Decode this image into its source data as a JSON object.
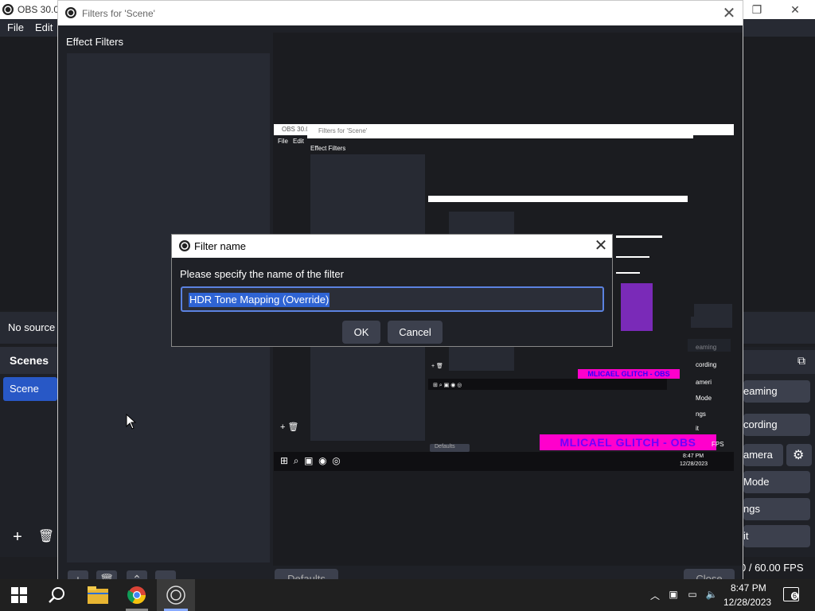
{
  "main_window": {
    "title": "OBS 30.0",
    "menu": [
      "File",
      "Edit"
    ],
    "sources_empty_text": "No source",
    "scenes_header": "Scenes",
    "scene_item": "Scene",
    "controls": [
      "eaming",
      "cording",
      "amera",
      "Mode",
      "ngs",
      "it"
    ],
    "status_fps": "0 / 60.00 FPS"
  },
  "filters_window": {
    "title": "Filters for 'Scene'",
    "effect_filters_label": "Effect Filters",
    "defaults_label": "Defaults",
    "close_label": "Close"
  },
  "preview": {
    "inner_title": "OBS 30.0",
    "inner_filters_title": "Filters for 'Scene'",
    "inner_menu_file": "File",
    "inner_menu_edit": "Edit",
    "inner_effect_filters": "Effect Filters",
    "glitch_text_a": "MLICAEL",
    "glitch_text_b": "GLITCH - OBS",
    "glitch_small": "MLICAEL GLITCH - OBS",
    "inner_time": "8:47 PM",
    "inner_date": "12/28/2023",
    "inner_defaults": "Defaults",
    "inner_controls": [
      "eaming",
      "cording",
      "ameri",
      "Mode",
      "ngs",
      "it"
    ],
    "inner_fps": "FPS"
  },
  "dialog": {
    "title": "Filter name",
    "prompt": "Please specify the name of the filter",
    "input_value": "HDR Tone Mapping (Override)",
    "ok_label": "OK",
    "cancel_label": "Cancel"
  },
  "taskbar": {
    "time": "8:47 PM",
    "date": "12/28/2023",
    "notification_count": "6"
  },
  "colors": {
    "accent": "#2858c6",
    "selection": "#2f64d4",
    "input_border": "#5b82e0",
    "glitch_pink": "#ff00cc"
  }
}
